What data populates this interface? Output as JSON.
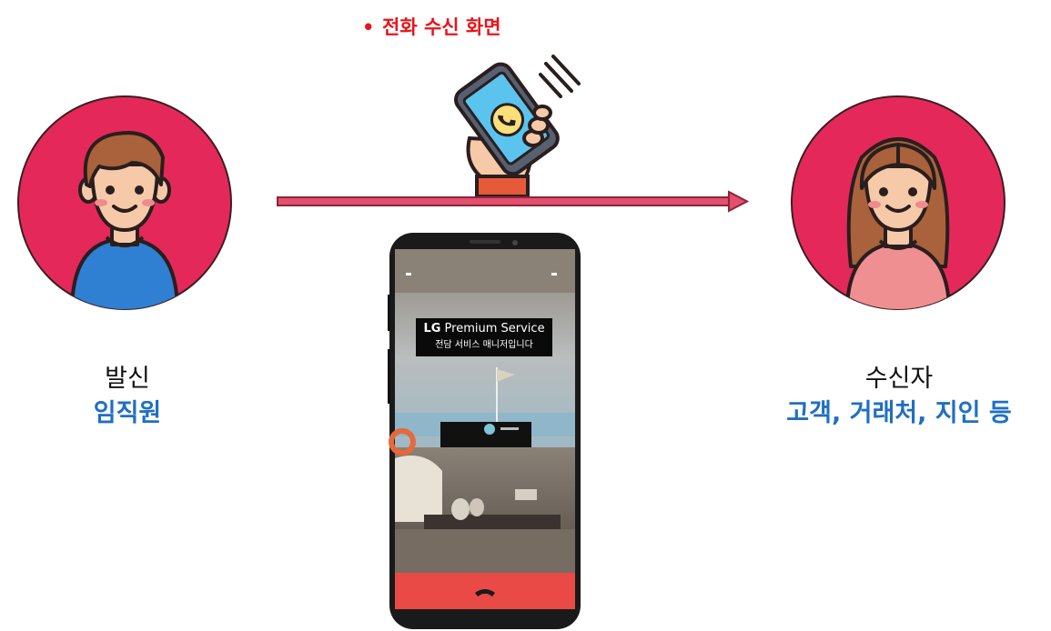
{
  "title": {
    "bullet": "•",
    "text": "전화 수신 화면"
  },
  "sender": {
    "role": "발신",
    "who": "임직원",
    "avatar_icon": "boy-avatar-icon"
  },
  "receiver": {
    "role": "수신자",
    "who": "고객, 거래처, 지인 등",
    "avatar_icon": "girl-avatar-icon"
  },
  "phone_screen": {
    "brand_lg": "LG",
    "brand_rest": " Premium Service",
    "tagline": "전담 서비스 매니저입니다",
    "decline_icon": "end-call-icon"
  },
  "colors": {
    "title": "#e8141b",
    "circle": "#e5285a",
    "arrow": "#e2506e",
    "accent_text": "#1f6fc1",
    "decline_bar": "#e94a45"
  }
}
